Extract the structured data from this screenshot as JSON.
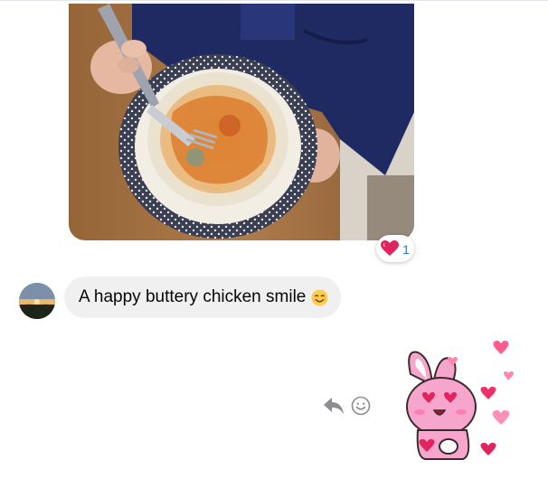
{
  "photo_message": {
    "reaction": {
      "emoji_name": "red-heart",
      "count": "1"
    }
  },
  "incoming_message": {
    "text": "A happy buttery chicken smile",
    "trailing_emoji": "smiling-face-with-smiling-eyes"
  },
  "message_actions": {
    "reply_icon": "reply-arrow-icon",
    "react_icon": "smiley-face-icon"
  },
  "sticker": {
    "description_name": "pink-bunny-heart-eyes-sticker"
  },
  "colors": {
    "reaction_count": "#1877f2",
    "bubble_bg": "#f0f0f0",
    "text": "#050505",
    "icon_gray": "#8a8d91",
    "heart_red": "#e0245e"
  }
}
